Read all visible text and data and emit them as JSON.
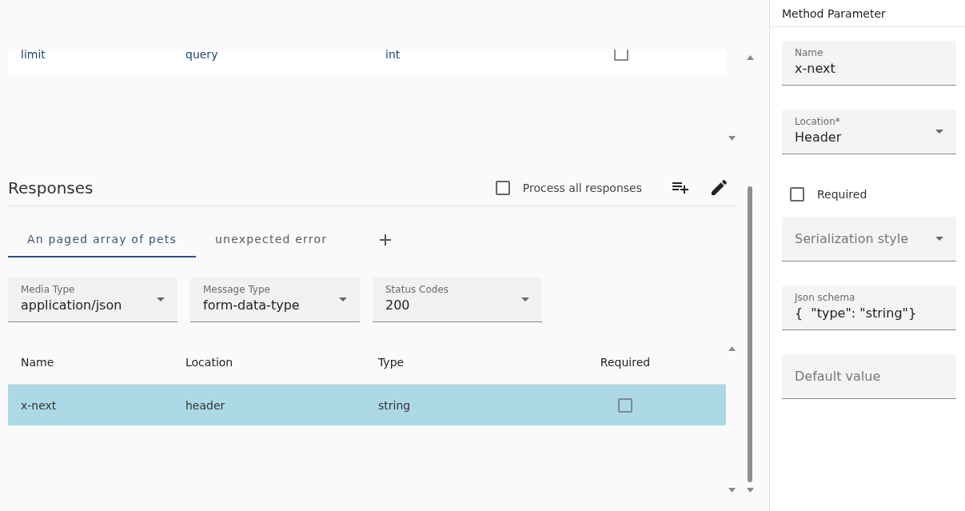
{
  "parameters": {
    "rows": [
      {
        "name": "limit",
        "location": "query",
        "type": "int",
        "required": false,
        "selected": false
      }
    ]
  },
  "responses": {
    "title": "Responses",
    "process_all": {
      "label": "Process all responses",
      "checked": false
    },
    "tabs": [
      {
        "label": "An paged array of pets",
        "selected": true
      },
      {
        "label": "unexpected error",
        "selected": false
      }
    ],
    "fields": [
      {
        "kind": "select",
        "label": "Media Type",
        "value": "application/json"
      },
      {
        "kind": "select",
        "label": "Message Type",
        "value": "form-data-type"
      },
      {
        "kind": "select",
        "label": "Status Codes",
        "value": "200"
      }
    ],
    "headers_table": {
      "columns": [
        "Name",
        "Location",
        "Type",
        "Required"
      ],
      "rows": [
        {
          "name": "x-next",
          "location": "header",
          "type": "string",
          "required": false,
          "selected": true
        }
      ]
    }
  },
  "method_parameter": {
    "title": "Method Parameter",
    "fields": [
      {
        "kind": "text",
        "label": "Name",
        "value": "x-next"
      },
      {
        "kind": "select",
        "label": "Location*",
        "value": "Header"
      },
      {
        "kind": "checkbox",
        "label": "Required",
        "checked": false
      },
      {
        "kind": "select",
        "placeholder": "Serialization style"
      },
      {
        "kind": "text",
        "label": "Json schema",
        "value": "{  \"type\": \"string\"}"
      },
      {
        "kind": "text",
        "placeholder": "Default value"
      }
    ]
  }
}
